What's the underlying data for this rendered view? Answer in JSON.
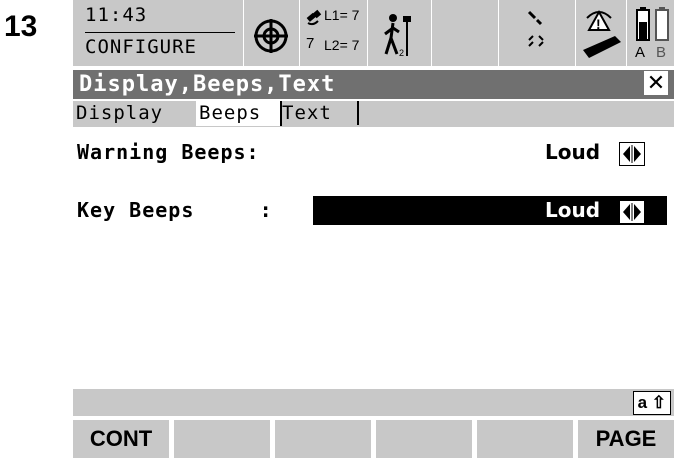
{
  "step_number": "13",
  "status": {
    "time": "11:43",
    "mode": "CONFIGURE",
    "satellites_visible": "7",
    "l1_label": "L1= 7",
    "l2_label": "L2= 7",
    "battery_a": "A",
    "battery_b": "B"
  },
  "titlebar": {
    "title": "Display,Beeps,Text",
    "close": "✕"
  },
  "tabs": [
    {
      "label": "Display",
      "active": false
    },
    {
      "label": "Beeps",
      "active": true
    },
    {
      "label": "Text",
      "active": false
    }
  ],
  "fields": {
    "warning_beeps": {
      "label": "Warning Beeps:",
      "value": "Loud"
    },
    "key_beeps": {
      "label": "Key Beeps     :",
      "value": "Loud"
    }
  },
  "input_mode": "a ⇧",
  "function_keys": {
    "f1": "CONT",
    "f2": "",
    "f3": "",
    "f4": "",
    "f5": "",
    "f6": "PAGE"
  }
}
